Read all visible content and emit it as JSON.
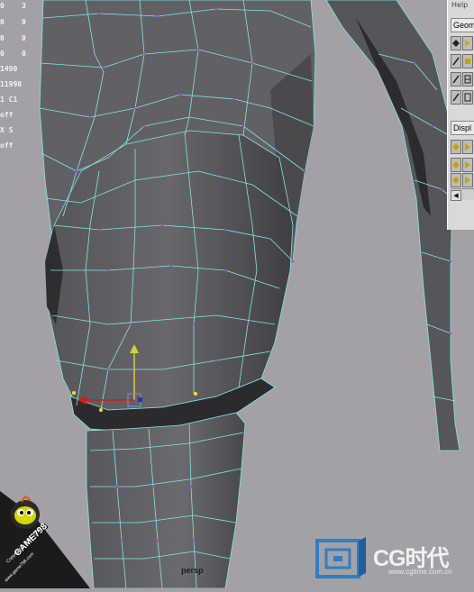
{
  "viewport": {
    "label": "persp",
    "background": "#a3a1a6",
    "mesh_fill": "#5f5f63",
    "wire_color": "#7fe7e7",
    "vertex_color": "#9b3bc7"
  },
  "hud": {
    "values": [
      "0",
      "3",
      "0",
      "0",
      "0",
      "0",
      "0",
      "0",
      "1490",
      "11998",
      "1 C1",
      "off",
      "X S",
      "off"
    ]
  },
  "panel": {
    "help_label": "Help",
    "tab_geometry": "Geom",
    "tab_display": "Displ"
  },
  "watermarks": {
    "game_title": "GAME798",
    "game_copyright": "Copyright © 2004-2007",
    "game_url": "www.game798.com",
    "cg_brand": "CG时代",
    "cg_url": "www.cgtime.com.cn"
  }
}
